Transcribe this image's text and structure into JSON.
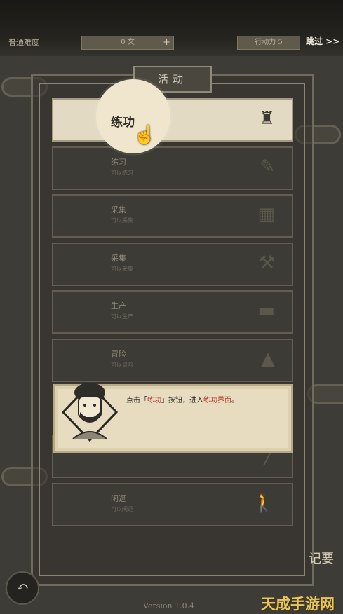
{
  "topbar": {
    "difficulty": "普通难度",
    "coins": "0 文",
    "coins_plus": "+",
    "action_points": "行动力 5",
    "skip": "跳过 >>"
  },
  "panel": {
    "title": "活动"
  },
  "activities": [
    {
      "name": "练功",
      "sub": "",
      "icon": "meditation-icon",
      "glyph": "♜"
    },
    {
      "name": "练习",
      "sub": "可以练习",
      "icon": "brush-icon",
      "glyph": "✎"
    },
    {
      "name": "采集",
      "sub": "可以采集",
      "icon": "basket-icon",
      "glyph": "▦"
    },
    {
      "name": "采集",
      "sub": "可以采集",
      "icon": "pickaxe-icon",
      "glyph": "⚒"
    },
    {
      "name": "生产",
      "sub": "可以生产",
      "icon": "anvil-icon",
      "glyph": "▬"
    },
    {
      "name": "冒险",
      "sub": "可以冒险",
      "icon": "mountain-icon",
      "glyph": "▲"
    },
    {
      "name": "",
      "sub": "",
      "icon": "",
      "glyph": ""
    },
    {
      "name": "",
      "sub": "",
      "icon": "staff-icon",
      "glyph": "╱"
    },
    {
      "name": "闲逛",
      "sub": "可以闲逛",
      "icon": "walking-icon",
      "glyph": "🚶"
    }
  ],
  "spotlight": {
    "label": "练功"
  },
  "dialog": {
    "prefix": "点击「",
    "highlight1": "练功",
    "middle": "」按钮，进入",
    "highlight2": "练功界面",
    "suffix": "。"
  },
  "bottom": {
    "back": "↶",
    "memo": "记要",
    "version": "Version 1.0.4",
    "watermark": "天成手游网"
  },
  "colors": {
    "highlight_red": "#b33a2b",
    "gold": "#e8c65a"
  }
}
